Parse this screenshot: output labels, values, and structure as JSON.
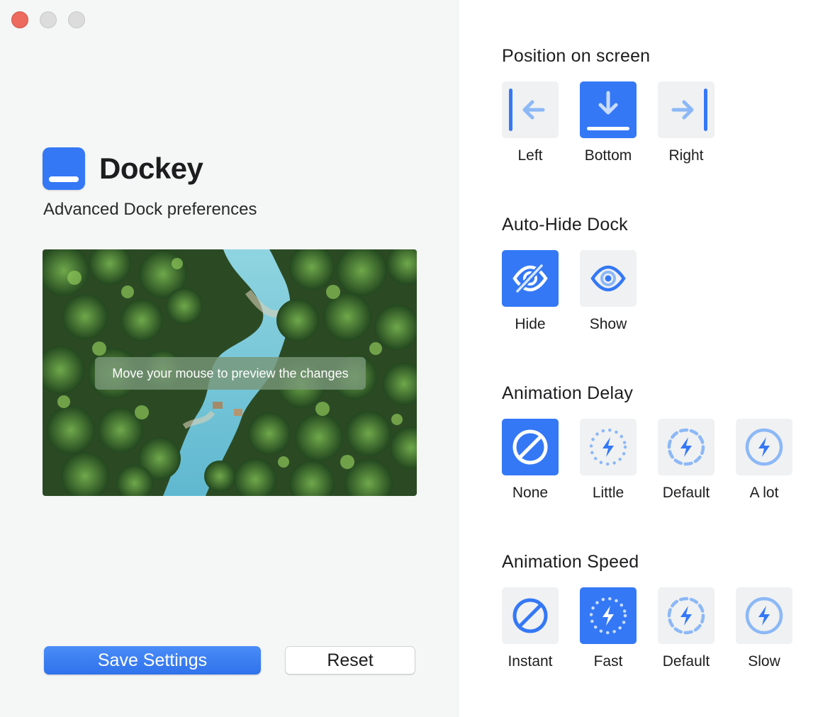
{
  "window": {
    "traffic_lights": [
      "close",
      "minimize",
      "maximize"
    ]
  },
  "app": {
    "title": "Dockey",
    "subtitle": "Advanced Dock preferences",
    "icon": "dock-app-icon",
    "accent": "#3478f6"
  },
  "preview": {
    "hint": "Move your mouse to preview the changes",
    "image": "aerial-tropical-forest-river"
  },
  "buttons": {
    "save_label": "Save Settings",
    "reset_label": "Reset"
  },
  "sections": {
    "position": {
      "title": "Position on screen",
      "selected": "Bottom",
      "options": [
        {
          "label": "Left",
          "icon": "dock-left-icon"
        },
        {
          "label": "Bottom",
          "icon": "dock-bottom-icon"
        },
        {
          "label": "Right",
          "icon": "dock-right-icon"
        }
      ]
    },
    "autohide": {
      "title": "Auto-Hide Dock",
      "selected": "Hide",
      "options": [
        {
          "label": "Hide",
          "icon": "eye-slash-icon"
        },
        {
          "label": "Show",
          "icon": "eye-icon"
        }
      ]
    },
    "delay": {
      "title": "Animation Delay",
      "selected": "None",
      "options": [
        {
          "label": "None",
          "icon": "prohibited-icon"
        },
        {
          "label": "Little",
          "icon": "bolt-dotted-circle-icon"
        },
        {
          "label": "Default",
          "icon": "bolt-dashed-circle-icon"
        },
        {
          "label": "A lot",
          "icon": "bolt-circle-icon"
        }
      ]
    },
    "speed": {
      "title": "Animation Speed",
      "selected": "Fast",
      "options": [
        {
          "label": "Instant",
          "icon": "prohibited-icon"
        },
        {
          "label": "Fast",
          "icon": "bolt-dotted-circle-icon"
        },
        {
          "label": "Default",
          "icon": "bolt-dashed-circle-icon"
        },
        {
          "label": "Slow",
          "icon": "bolt-circle-icon"
        }
      ]
    }
  }
}
